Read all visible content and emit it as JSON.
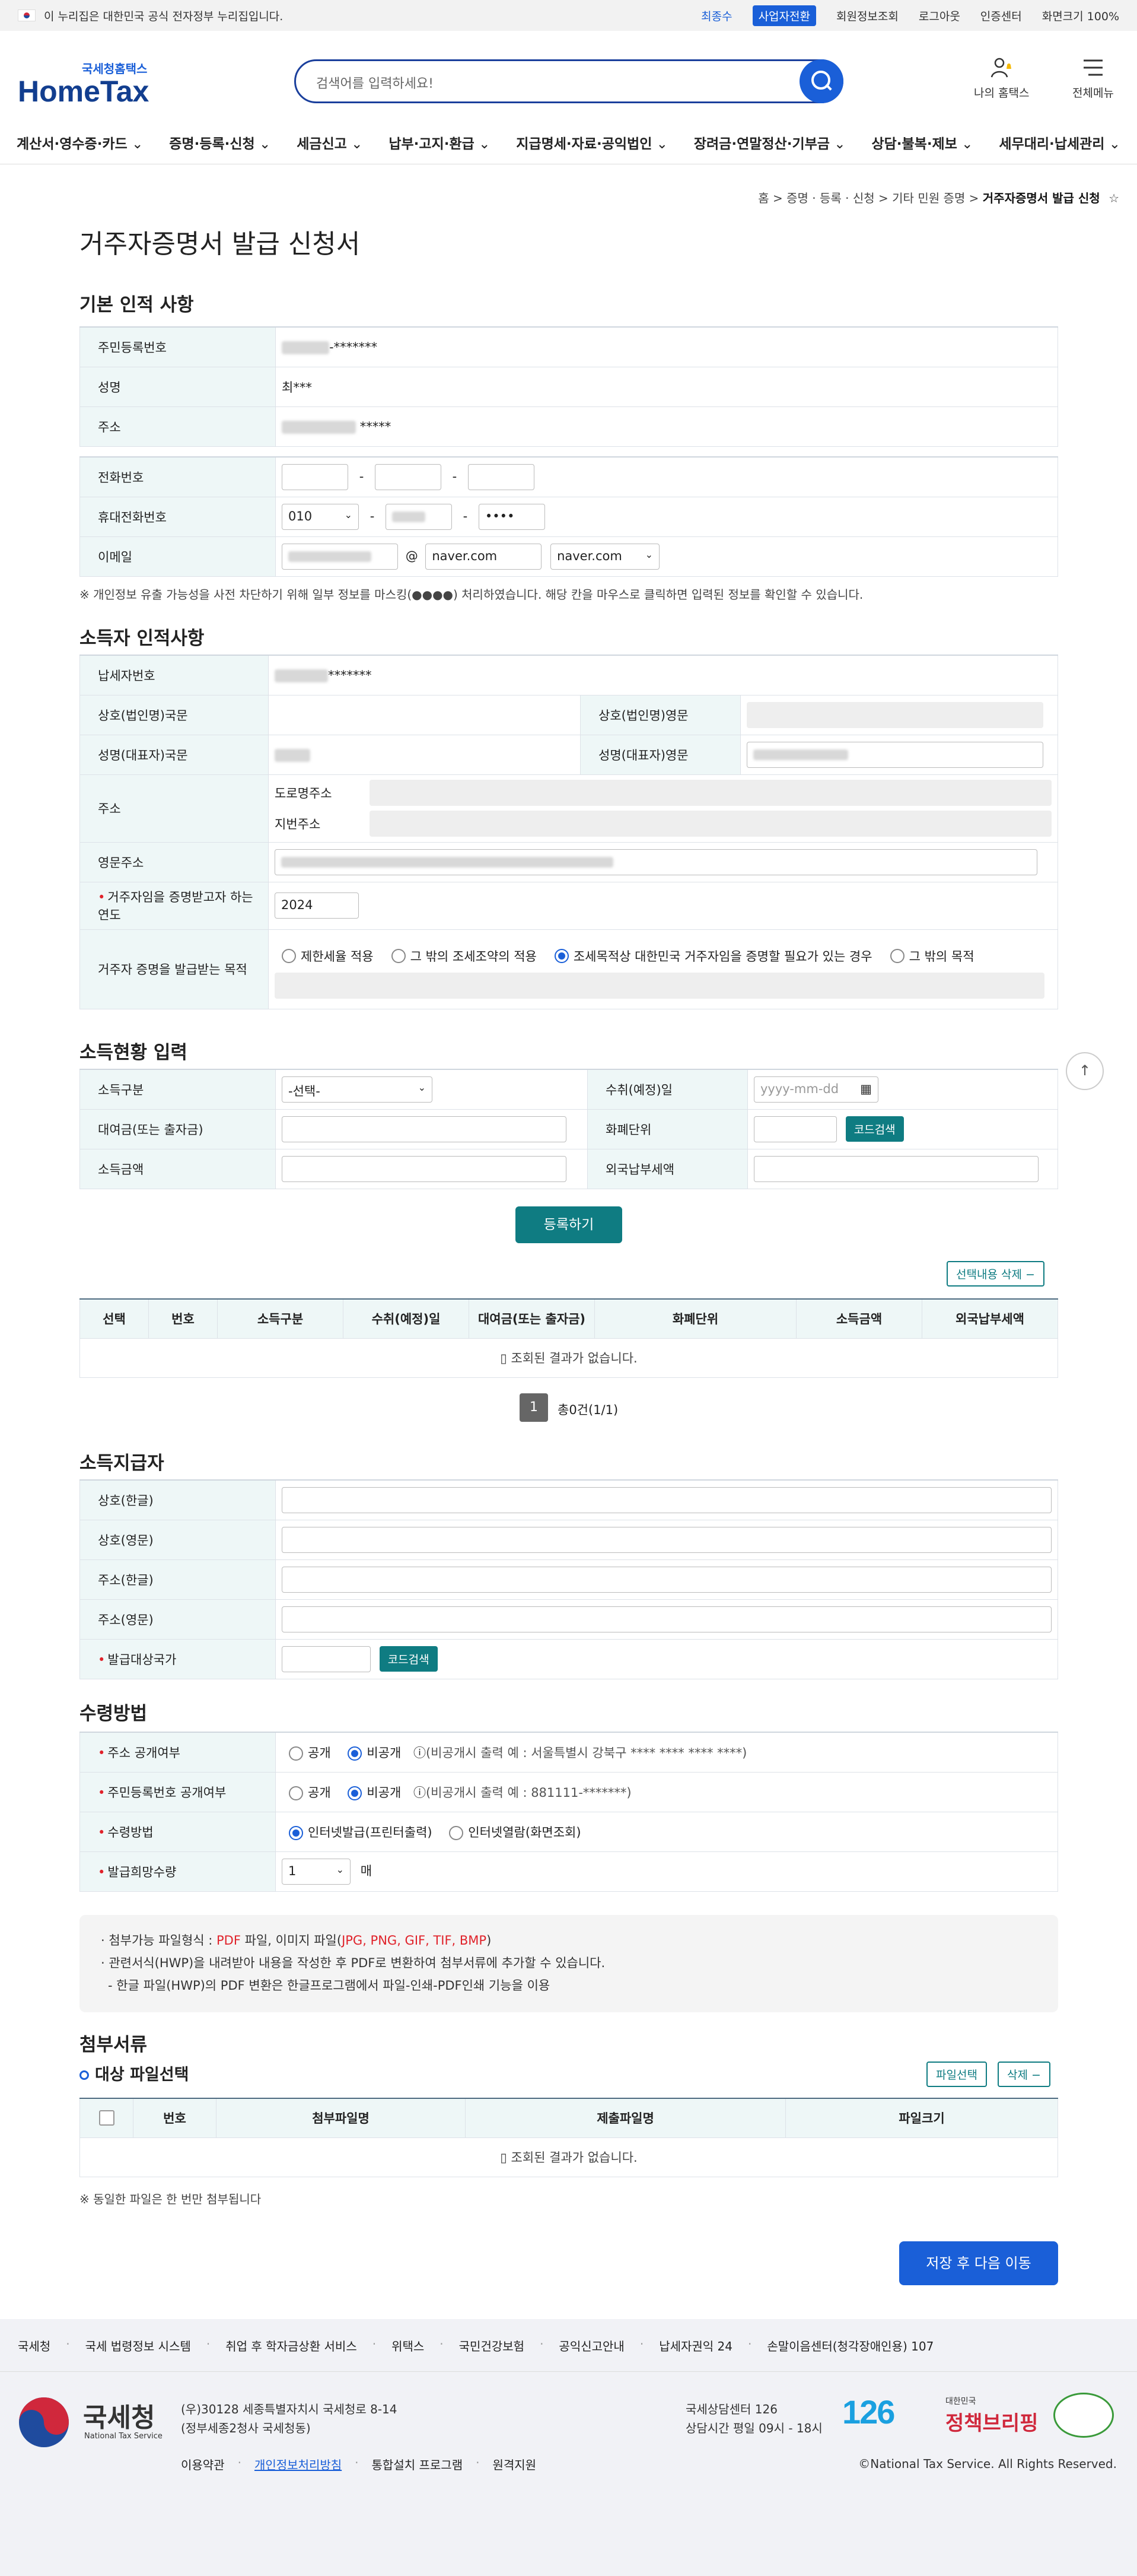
{
  "topbar": {
    "notice": "이 누리집은 대한민국 공식 전자정부 누리집입니다.",
    "links": [
      "최종수",
      "사업자전환",
      "회원정보조회",
      "로그아웃",
      "인증센터",
      "화면크기 100%"
    ]
  },
  "header": {
    "logo_sub": "국세청홈택스",
    "logo_main": "HomeTax",
    "search_placeholder": "검색어를 입력하세요!",
    "my_hometax": "나의 홈택스",
    "all_menu": "전체메뉴"
  },
  "nav": [
    "계산서·영수증·카드",
    "증명·등록·신청",
    "세금신고",
    "납부·고지·환급",
    "지급명세·자료·공익법인",
    "장려금·연말정산·기부금",
    "상담·불복·제보",
    "세무대리·납세관리"
  ],
  "breadcrumb": {
    "items": [
      "홈",
      "증명 · 등록 · 신청",
      "기타 민원 증명"
    ],
    "current": "거주자증명서 발급 신청"
  },
  "page_title": "거주자증명서 발급 신청서",
  "basic": {
    "title": "기본 인적 사항",
    "rrn_label": "주민등록번호",
    "rrn_mask": "-*******",
    "name_label": "성명",
    "name_value": "최***",
    "addr_label": "주소",
    "addr_mask": "*****",
    "tel_label": "전화번호",
    "mobile_label": "휴대전화번호",
    "mobile_prefix": "010",
    "mobile_last": "••••",
    "email_label": "이메일",
    "email_domain": "naver.com",
    "email_select": "naver.com",
    "dash": "-",
    "at": "@",
    "notice": "※ 개인정보 유출 가능성을 사전 차단하기 위해 일부 정보를 마스킹(●●●●) 처리하였습니다. 해당 칸을 마우스로 클릭하면 입력된 정보를 확인할 수 있습니다."
  },
  "income_person": {
    "title": "소득자 인적사항",
    "taxpayer_label": "납세자번호",
    "taxpayer_mask": "*******",
    "company_kr": "상호(법인명)국문",
    "company_en": "상호(법인명)영문",
    "rep_kr": "성명(대표자)국문",
    "rep_en": "성명(대표자)영문",
    "addr_label": "주소",
    "road_addr": "도로명주소",
    "lot_addr": "지번주소",
    "eng_addr": "영문주소",
    "year_label": "거주자임을 증명받고자 하는 연도",
    "year_value": "2024",
    "purpose_label": "거주자 증명을 발급받는 목적",
    "purposes": [
      "제한세율 적용",
      "그 밖의 조세조약의 적용",
      "조세목적상 대한민국 거주자임을 증명할 필요가 있는 경우",
      "그 밖의 목적"
    ]
  },
  "income_status": {
    "title": "소득현황 입력",
    "type_label": "소득구분",
    "type_value": "-선택-",
    "date_label": "수취(예정)일",
    "date_placeholder": "yyyy-mm-dd",
    "loan_label": "대여금(또는 출자금)",
    "currency_label": "화폐단위",
    "code_search": "코드검색",
    "amount_label": "소득금액",
    "foreign_tax_label": "외국납부세액",
    "register": "등록하기",
    "delete_selected": "선택내용 삭제"
  },
  "grid1": {
    "headers": [
      "선택",
      "번호",
      "소득구분",
      "수취(예정)일",
      "대여금(또는 출자금)",
      "화폐단위",
      "소득금액",
      "외국납부세액"
    ],
    "empty": "조회된 결과가 없습니다.",
    "page": "1",
    "total": "총0건(1/1)"
  },
  "payer": {
    "title": "소득지급자",
    "rows": [
      "상호(한글)",
      "상호(영문)",
      "주소(한글)",
      "주소(영문)"
    ],
    "country_label": "발급대상국가",
    "code_search": "코드검색"
  },
  "receive": {
    "title": "수령방법",
    "addr_public_label": "주소 공개여부",
    "rrn_public_label": "주민등록번호 공개여부",
    "method_label": "수령방법",
    "qty_label": "발급희망수량",
    "public": "공개",
    "private": "비공개",
    "addr_example": "(비공개시 출력 예 : 서울특별시 강북구 **** **** **** ****)",
    "rrn_example": "(비공개시 출력 예 : 881111-*******)",
    "method1": "인터넷발급(프린터출력)",
    "method2": "인터넷열람(화면조회)",
    "qty_value": "1",
    "qty_unit": "매"
  },
  "info": {
    "l1a": "· 첨부가능 파일형식 : ",
    "l1b": "PDF",
    "l1c": " 파일, 이미지 파일(",
    "l1d": "JPG, PNG, GIF, TIF, BMP",
    "l1e": ")",
    "l2": "· 관련서식(HWP)을 내려받아 내용을 작성한 후 PDF로 변환하여 첨부서류에 추가할 수 있습니다.",
    "l3": "- 한글 파일(HWP)의 PDF 변환은 한글프로그램에서 파일-인쇄-PDF인쇄 기능을 이용"
  },
  "attach": {
    "title": "첨부서류",
    "sub": "대상 파일선택",
    "file_select": "파일선택",
    "delete": "삭제",
    "headers": [
      "번호",
      "첨부파일명",
      "제출파일명",
      "파일크기"
    ],
    "empty": "조회된 결과가 없습니다.",
    "note": "※ 동일한 파일은 한 번만 첨부됩니다",
    "save_next": "저장 후 다음 이동"
  },
  "footer": {
    "links": [
      "국세청",
      "국세 법령정보 시스템",
      "취업 후 학자금상환 서비스",
      "위택스",
      "국민건강보험",
      "공익신고안내",
      "납세자권익 24",
      "손말이음센터(청각장애인용) 107"
    ],
    "org": "국세청",
    "org_en": "National Tax Service",
    "addr1": "(우)30128 세종특별자치시 국세청로 8-14",
    "addr2": "(정부세종2청사 국세청동)",
    "center": "국세상담센터 126",
    "hours": "상담시간 평일 09시 - 18시",
    "num126": "126",
    "policy_sub": "대한민국",
    "policy": "정책브리핑",
    "bottom_links": [
      "이용약관",
      "개인정보처리방침",
      "통합설치 프로그램",
      "원격지원"
    ],
    "copyright": "©National Tax Service. All Rights Reserved."
  }
}
